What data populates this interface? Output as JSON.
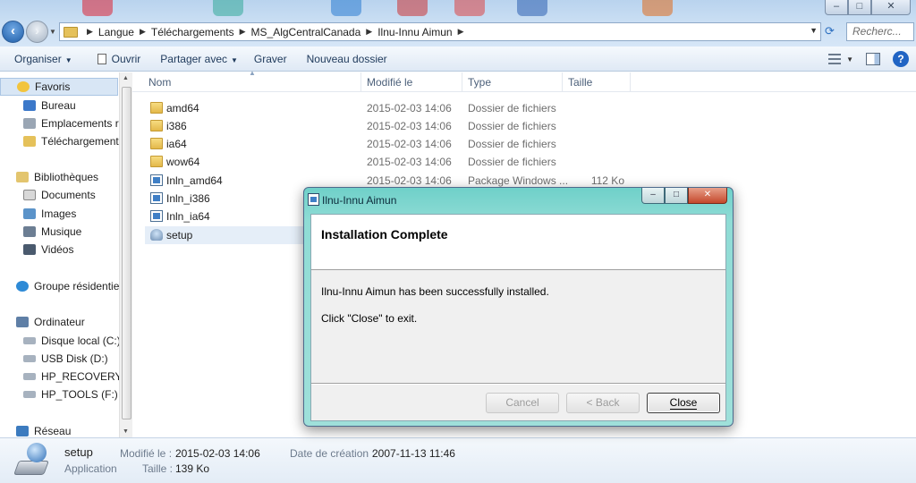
{
  "address_bar": {
    "breadcrumb": [
      "Langue",
      "Téléchargements",
      "MS_AlgCentralCanada",
      "Ilnu-Innu Aimun"
    ],
    "search_placeholder": "Recherc..."
  },
  "window_controls": {
    "minimize": "–",
    "maximize": "□",
    "close": "✕"
  },
  "toolbar": {
    "organize": "Organiser",
    "open": "Ouvrir",
    "share": "Partager avec",
    "burn": "Graver",
    "new_folder": "Nouveau dossier",
    "help": "?"
  },
  "nav": {
    "favorites": "Favoris",
    "desktop": "Bureau",
    "recent": "Emplacements réc",
    "downloads": "Téléchargements",
    "libraries": "Bibliothèques",
    "documents": "Documents",
    "images": "Images",
    "music": "Musique",
    "videos": "Vidéos",
    "homegroup": "Groupe résidentiel",
    "computer": "Ordinateur",
    "drive_c": "Disque local (C:)",
    "drive_d": "USB Disk (D:)",
    "drive_e": "HP_RECOVERY (E:",
    "drive_f": "HP_TOOLS (F:)",
    "network": "Réseau"
  },
  "columns": {
    "name": "Nom",
    "modified": "Modifié le",
    "type": "Type",
    "size": "Taille"
  },
  "files": [
    {
      "name": "amd64",
      "modified": "2015-02-03 14:06",
      "type": "Dossier de fichiers",
      "size": "",
      "icon": "folder-icon"
    },
    {
      "name": "i386",
      "modified": "2015-02-03 14:06",
      "type": "Dossier de fichiers",
      "size": "",
      "icon": "folder-icon"
    },
    {
      "name": "ia64",
      "modified": "2015-02-03 14:06",
      "type": "Dossier de fichiers",
      "size": "",
      "icon": "folder-icon"
    },
    {
      "name": "wow64",
      "modified": "2015-02-03 14:06",
      "type": "Dossier de fichiers",
      "size": "",
      "icon": "folder-icon"
    },
    {
      "name": "Inln_amd64",
      "modified": "2015-02-03 14:06",
      "type": "Package Windows ...",
      "size": "112 Ko",
      "icon": "msi-package-icon"
    },
    {
      "name": "Inln_i386",
      "modified": "",
      "type": "",
      "size": "",
      "icon": "msi-package-icon"
    },
    {
      "name": "Inln_ia64",
      "modified": "",
      "type": "",
      "size": "",
      "icon": "msi-package-icon"
    },
    {
      "name": "setup",
      "modified": "",
      "type": "",
      "size": "",
      "icon": "setup-icon"
    }
  ],
  "details": {
    "name": "setup",
    "kind": "Application",
    "modified_label": "Modifié le :",
    "modified_value": "2015-02-03 14:06",
    "created_label": "Date de création :",
    "created_value": "2007-11-13 11:46",
    "size_label": "Taille :",
    "size_value": "139 Ko"
  },
  "dialog": {
    "title": "Ilnu-Innu Aimun",
    "heading": "Installation Complete",
    "message1": "Ilnu-Innu Aimun has been successfully installed.",
    "message2": "Click \"Close\" to exit.",
    "cancel": "Cancel",
    "back": "< Back",
    "close": "Close"
  },
  "colors": {
    "dialog_frame": "#8fdcd5",
    "selection": "#e5eef8",
    "toolbar_text": "#1e395b"
  }
}
